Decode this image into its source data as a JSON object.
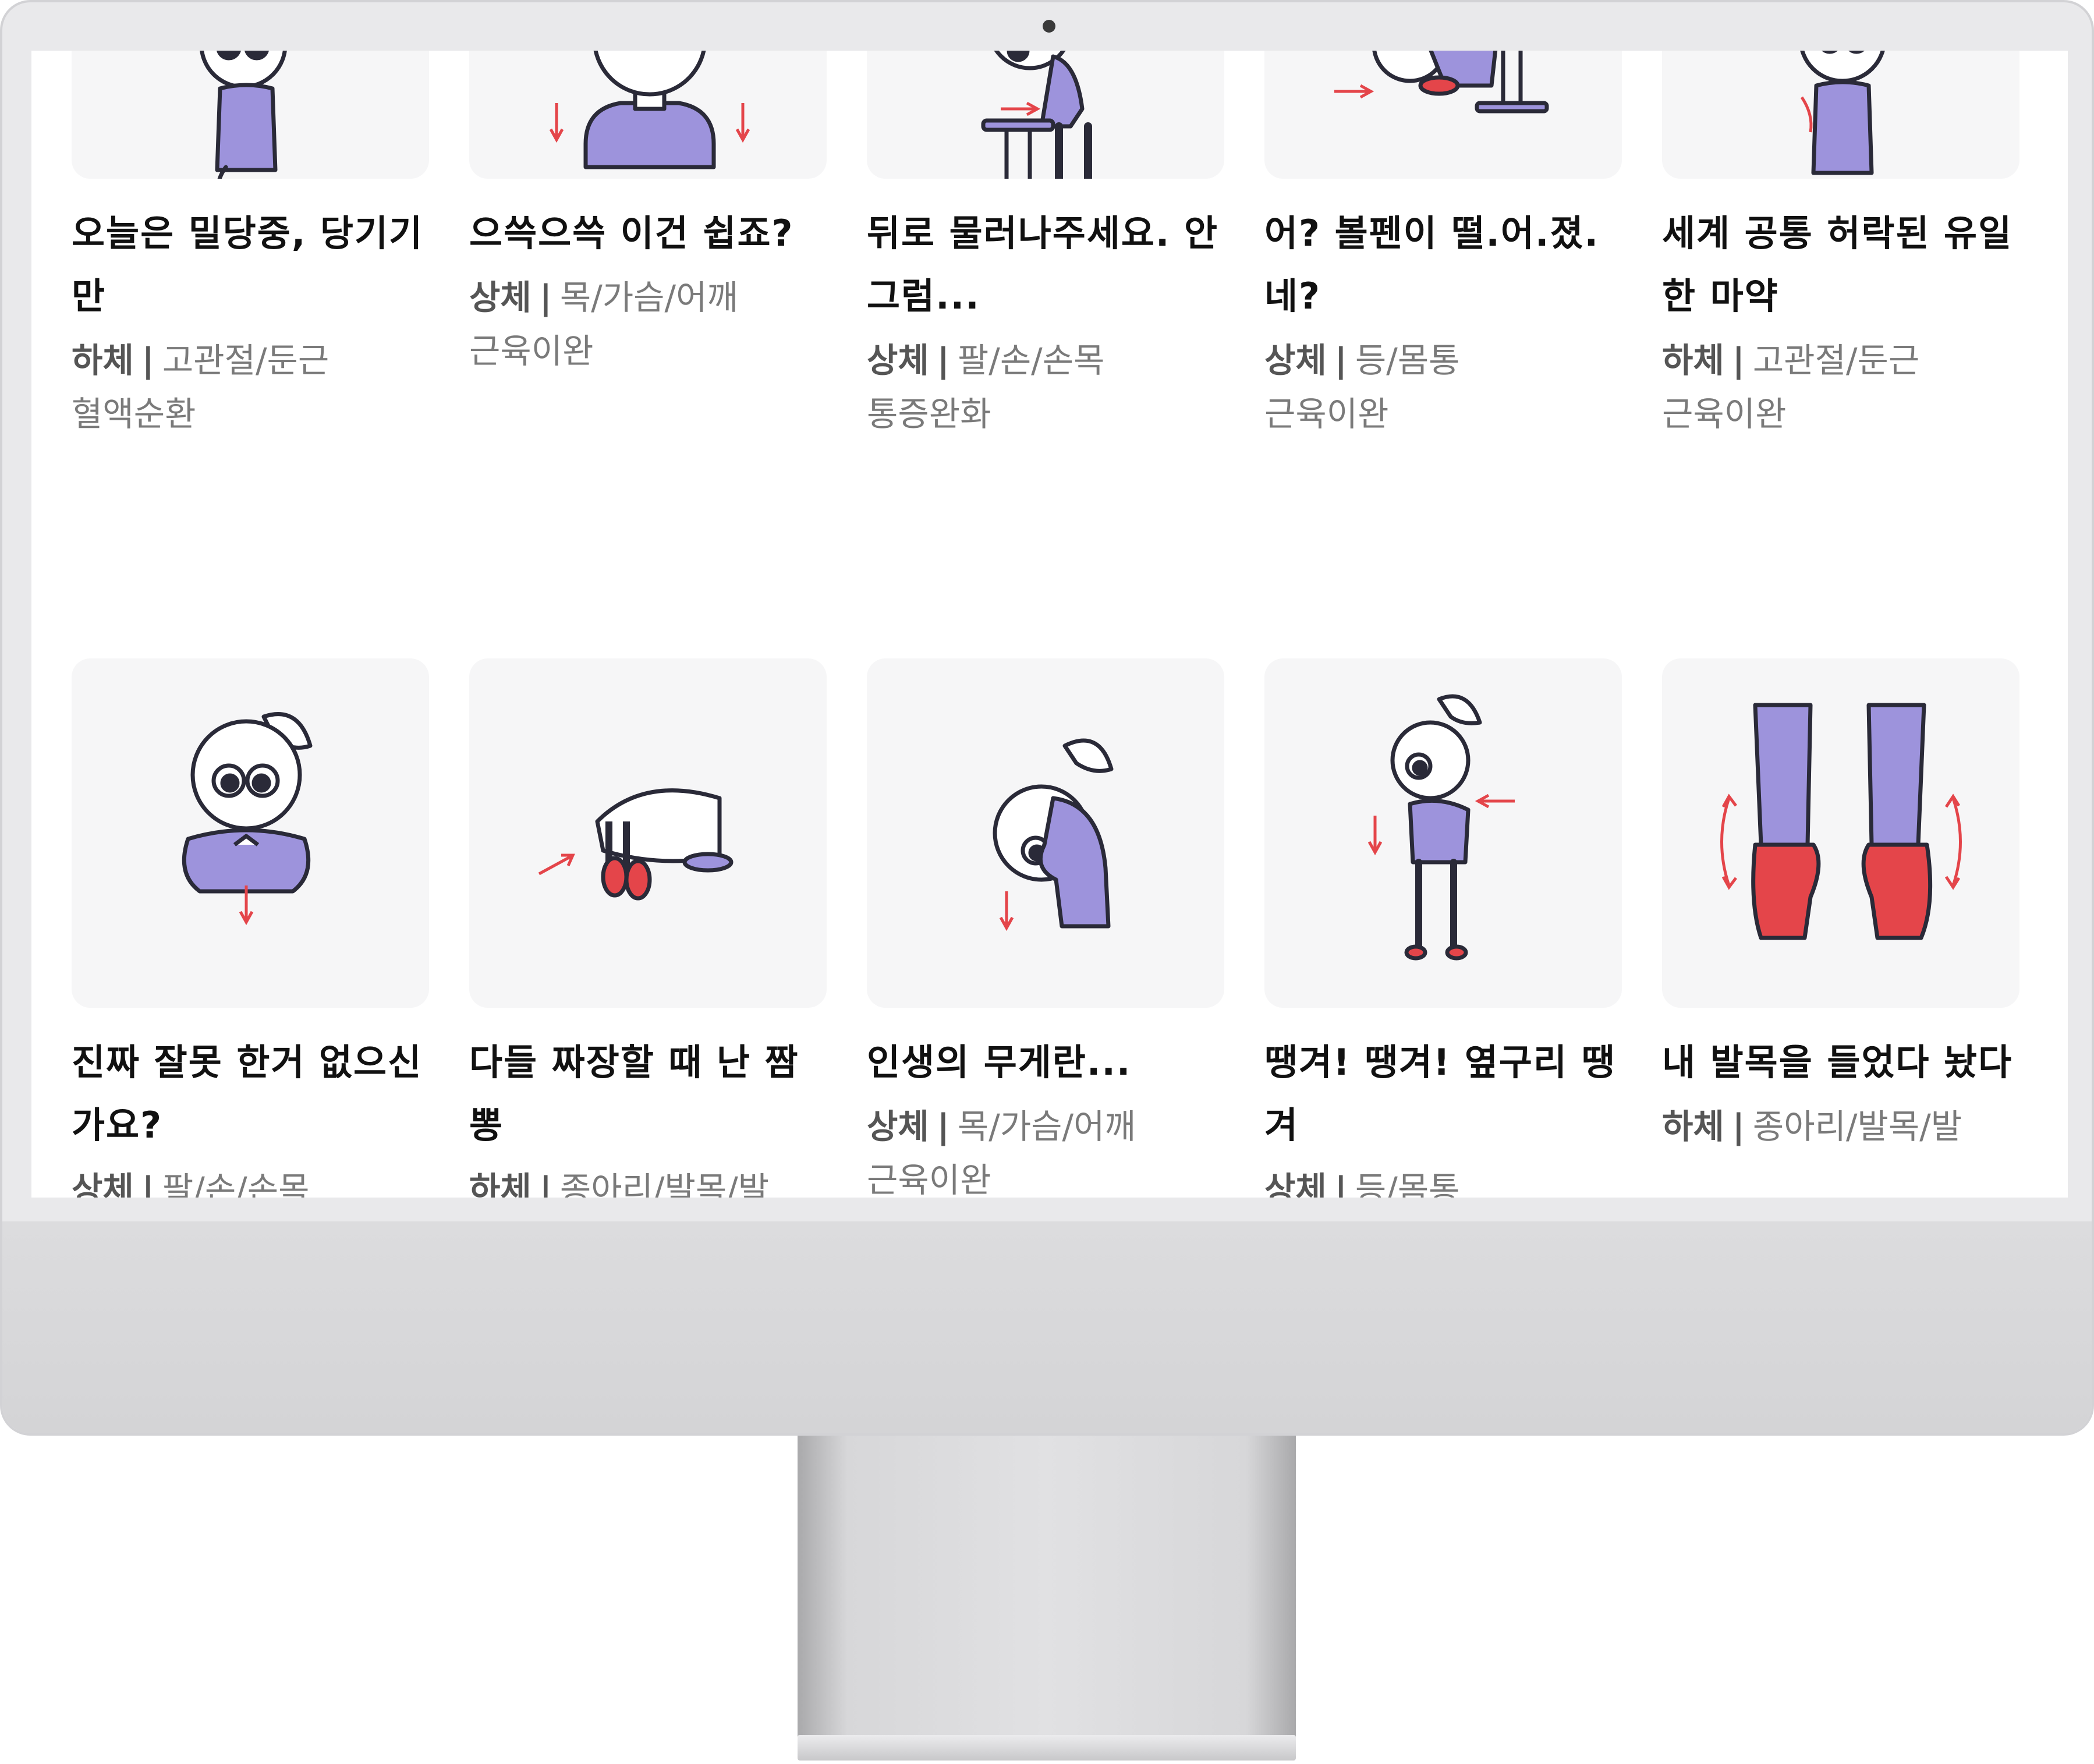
{
  "cards": [
    {
      "title": "오늘은 밀당중, 당기기만",
      "category": "하체",
      "separator": "|",
      "parts": "고관절/둔근",
      "effect": "혈액순환",
      "illustration": "seated-knee-pull-icon"
    },
    {
      "title": "으쓱으쓱 이건 쉽죠?",
      "category": "상체",
      "separator": "|",
      "parts": "목/가슴/어깨",
      "effect": "근육이완",
      "illustration": "shoulder-shrug-icon"
    },
    {
      "title": "뒤로 물러나주세요. 안그럼...",
      "category": "상체",
      "separator": "|",
      "parts": "팔/손/손목",
      "effect": "통증완화",
      "illustration": "table-lean-stretch-icon"
    },
    {
      "title": "어? 볼펜이 떨.어.졌.네?",
      "category": "상체",
      "separator": "|",
      "parts": "등/몸통",
      "effect": "근육이완",
      "illustration": "pen-pickup-bend-icon"
    },
    {
      "title": "세계 공통 허락된 유일한 마약",
      "category": "하체",
      "separator": "|",
      "parts": "고관절/둔근",
      "effect": "근육이완",
      "illustration": "seated-leg-cross-icon"
    },
    {
      "title": "진짜 잘못 한거 없으신가요?",
      "category": "상체",
      "separator": "|",
      "parts": "팔/손/손목",
      "effect": "",
      "illustration": "wrist-press-icon"
    },
    {
      "title": "다들 짜장할 때 난 짬뽕",
      "category": "하체",
      "separator": "|",
      "parts": "종아리/발목/발",
      "effect": "",
      "illustration": "seated-forward-fold-icon"
    },
    {
      "title": "인생의 무게란...",
      "category": "상체",
      "separator": "|",
      "parts": "목/가슴/어깨",
      "effect": "근육이완",
      "illustration": "neck-side-stretch-icon"
    },
    {
      "title": "땡겨! 땡겨! 옆구리 땡겨",
      "category": "상체",
      "separator": "|",
      "parts": "등/몸통",
      "effect": "",
      "illustration": "side-bend-icon"
    },
    {
      "title": "내 발목을 들었다 놨다",
      "category": "하체",
      "separator": "|",
      "parts": "종아리/발목/발",
      "effect": "",
      "illustration": "ankle-raise-icon"
    }
  ],
  "colors": {
    "purple": "#9d93dc",
    "red": "#e4454a",
    "outline": "#2a2a38",
    "card_bg": "#f6f6f7"
  }
}
